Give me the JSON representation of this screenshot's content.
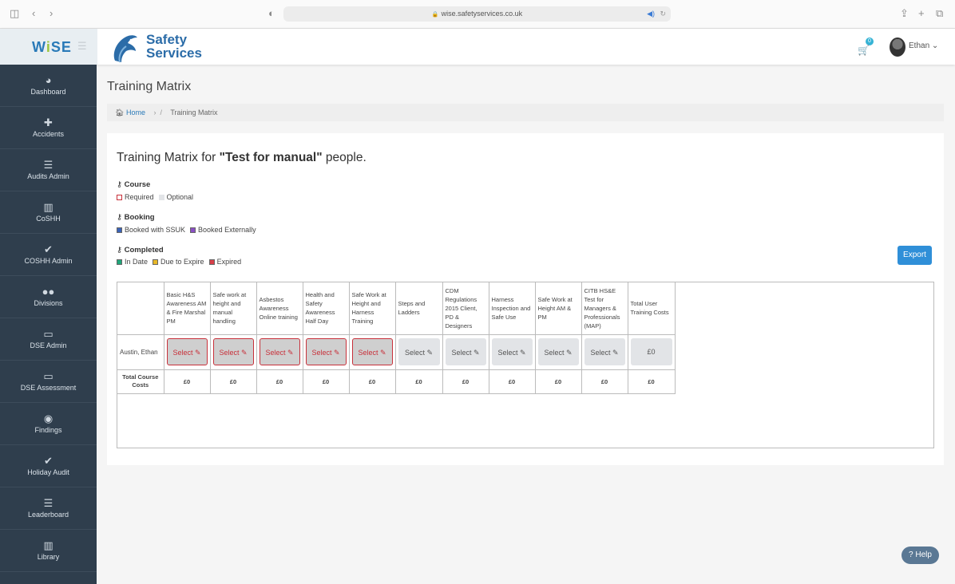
{
  "browser": {
    "url": "wise.safetyservices.co.uk"
  },
  "topbar": {
    "app_logo_main": "W",
    "app_logo_i": "i",
    "app_logo_rest": "SE",
    "brand_line1": "Safety",
    "brand_line2": "Services",
    "cart_count": "0",
    "user_name": "Ethan"
  },
  "sidebar": {
    "items": [
      {
        "label": "Dashboard",
        "icon": "dashboard-icon",
        "glyph": "◕"
      },
      {
        "label": "Accidents",
        "icon": "medkit-icon",
        "glyph": "✚"
      },
      {
        "label": "Audits Admin",
        "icon": "list-icon",
        "glyph": "☰"
      },
      {
        "label": "CoSHH",
        "icon": "book-icon",
        "glyph": "▥"
      },
      {
        "label": "COSHH Admin",
        "icon": "check-icon",
        "glyph": "✔"
      },
      {
        "label": "Divisions",
        "icon": "users-icon",
        "glyph": "●●"
      },
      {
        "label": "DSE Admin",
        "icon": "monitor-icon",
        "glyph": "▭"
      },
      {
        "label": "DSE Assessment",
        "icon": "monitor-icon",
        "glyph": "▭"
      },
      {
        "label": "Findings",
        "icon": "eye-icon",
        "glyph": "◉"
      },
      {
        "label": "Holiday Audit",
        "icon": "check-icon",
        "glyph": "✔"
      },
      {
        "label": "Leaderboard",
        "icon": "list-icon",
        "glyph": "☰"
      },
      {
        "label": "Library",
        "icon": "book-icon",
        "glyph": "▥"
      }
    ]
  },
  "page": {
    "title": "Training Matrix"
  },
  "breadcrumb": {
    "home": "Home",
    "current": "Training Matrix"
  },
  "matrix": {
    "heading_prefix": "Training Matrix for ",
    "heading_group": "\"Test for manual\"",
    "heading_suffix": " people.",
    "legend": {
      "course": {
        "title": "Course",
        "items": [
          {
            "label": "Required",
            "color": "#ffffff",
            "border": "#c8303a"
          },
          {
            "label": "Optional",
            "color": "#e2e4e7",
            "border": "#e2e4e7"
          }
        ]
      },
      "booking": {
        "title": "Booking",
        "items": [
          {
            "label": "Booked with SSUK",
            "color": "#3a63b8"
          },
          {
            "label": "Booked Externally",
            "color": "#8a4fc4"
          }
        ]
      },
      "completed": {
        "title": "Completed",
        "items": [
          {
            "label": "In Date",
            "color": "#1fa67a"
          },
          {
            "label": "Due to Expire",
            "color": "#e8b828"
          },
          {
            "label": "Expired",
            "color": "#d9404a"
          }
        ]
      }
    },
    "export_label": "Export",
    "columns": [
      {
        "label": "Basic H&S Awareness AM & Fire Marshal PM",
        "required": true
      },
      {
        "label": "Safe work at height and manual handling",
        "required": true
      },
      {
        "label": "Asbestos Awareness Online training",
        "required": true
      },
      {
        "label": "Health and Safety Awareness Half Day",
        "required": true
      },
      {
        "label": "Safe Work at Height and Harness Training",
        "required": true
      },
      {
        "label": "Steps and Ladders",
        "required": false
      },
      {
        "label": "CDM Regulations 2015 Client, PD & Designers",
        "required": false
      },
      {
        "label": "Harness Inspection and Safe Use",
        "required": false
      },
      {
        "label": "Safe Work at Height AM & PM",
        "required": false
      },
      {
        "label": "CITB HS&E Test for Managers & Professionals (MAP)",
        "required": false
      }
    ],
    "total_user_header": "Total User Training Costs",
    "rows": [
      {
        "name": "Austin, Ethan",
        "cell_label": "Select",
        "total": "£0"
      }
    ],
    "total_course_label": "Total Course Costs",
    "course_totals": [
      "£0",
      "£0",
      "£0",
      "£0",
      "£0",
      "£0",
      "£0",
      "£0",
      "£0",
      "£0"
    ],
    "grand_total": "£0"
  },
  "help_label": "Help"
}
